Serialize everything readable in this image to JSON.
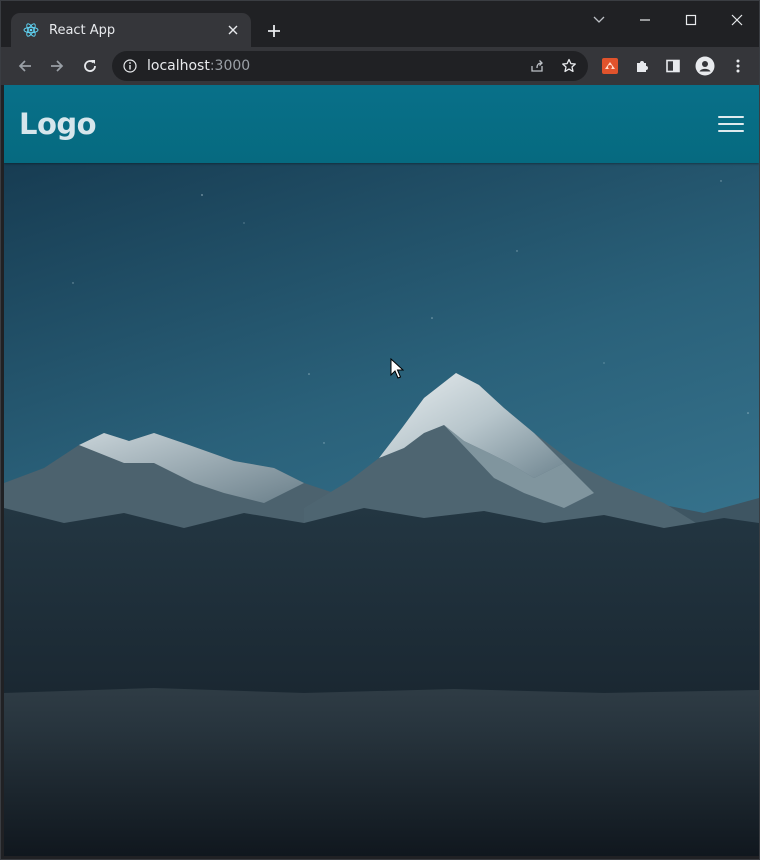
{
  "browser": {
    "tab": {
      "title": "React App",
      "favicon": "react-logo-icon"
    },
    "new_tab": "plus-icon",
    "window_controls": [
      "chevron-down-icon",
      "minimize-icon",
      "maximize-icon",
      "close-icon"
    ],
    "address_bar": {
      "host": "localhost",
      "port": ":3000",
      "info_icon": "info-icon"
    },
    "toolbar_icons": [
      "back-icon",
      "forward-icon",
      "reload-icon",
      "share-icon",
      "star-icon",
      "extension-app-icon",
      "puzzle-icon",
      "sidepanel-icon",
      "profile-icon",
      "kebab-menu-icon"
    ]
  },
  "page": {
    "navbar": {
      "logo_text": "Logo",
      "menu_icon": "hamburger-menu-icon",
      "background": "#087089"
    },
    "hero": {
      "image": "mountain-night-landscape"
    }
  },
  "colors": {
    "tab_strip": "#202124",
    "toolbar": "#35363a",
    "navbar": "#087089",
    "sky_top": "#173c52",
    "sky_bottom": "#3a7893"
  }
}
